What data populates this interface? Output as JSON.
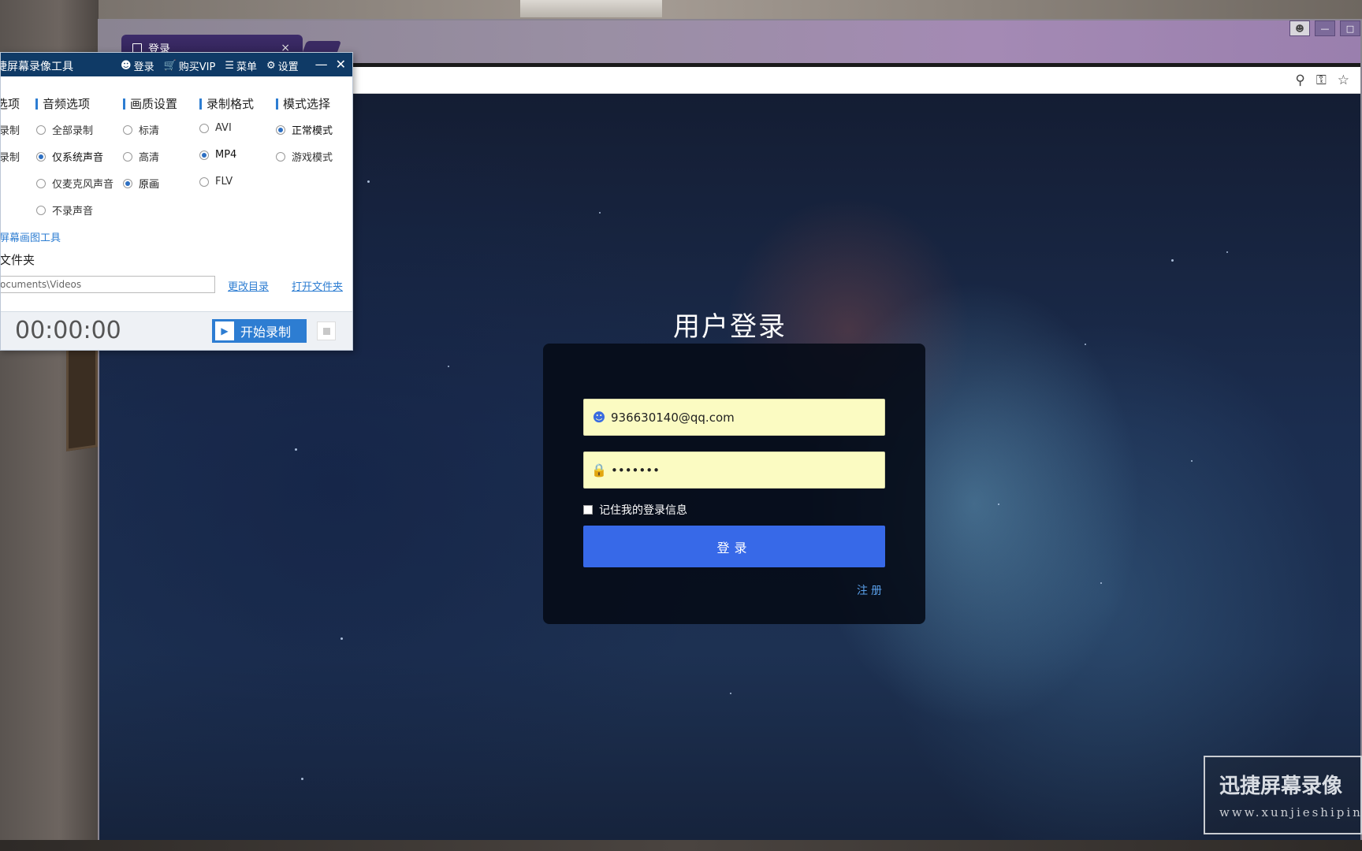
{
  "browser": {
    "tab_title": "登录",
    "tab_close": "×"
  },
  "login": {
    "title": "用户登录",
    "username_value": "936630140@qq.com",
    "password_value": "•••••••",
    "remember_label": "记住我的登录信息",
    "submit_label": "登录",
    "register_label": "注册"
  },
  "recorder": {
    "app_title": "捷屏幕录像工具",
    "nav": {
      "login": "登录",
      "buy_vip": "购买VIP",
      "menu": "菜单",
      "settings": "设置"
    },
    "columns": {
      "video": "选项",
      "audio": "音频选项",
      "quality": "画质设置",
      "format": "录制格式",
      "mode": "模式选择"
    },
    "video_options": [
      "录制",
      "录制"
    ],
    "audio_options": [
      {
        "label": "全部录制",
        "selected": false
      },
      {
        "label": "仅系统声音",
        "selected": true
      },
      {
        "label": "仅麦克风声音",
        "selected": false
      },
      {
        "label": "不录声音",
        "selected": false
      }
    ],
    "quality_options": [
      {
        "label": "标清",
        "selected": false
      },
      {
        "label": "高清",
        "selected": false
      },
      {
        "label": "原画",
        "selected": true
      }
    ],
    "format_options": [
      {
        "label": "AVI",
        "selected": false
      },
      {
        "label": "MP4",
        "selected": true
      },
      {
        "label": "FLV",
        "selected": false
      }
    ],
    "mode_options": [
      {
        "label": "正常模式",
        "selected": true
      },
      {
        "label": "游戏模式",
        "selected": false
      }
    ],
    "draw_tool_link": "屏幕画图工具",
    "output_folder_label": "文件夹",
    "output_path": "ocuments\\Videos",
    "change_dir_link": "更改目录",
    "open_folder_link": "打开文件夹",
    "timer_label": "：",
    "timer": "00:00:00",
    "start_label": "开始录制"
  },
  "watermark": {
    "main": "迅捷屏幕录像",
    "sub": "www.xunjieshipin"
  },
  "colors": {
    "login_button": "#3769e8",
    "field_bg": "#fbfbc2",
    "recorder_titlebar": "#0f3a66",
    "recorder_accent": "#2d7dd2"
  }
}
